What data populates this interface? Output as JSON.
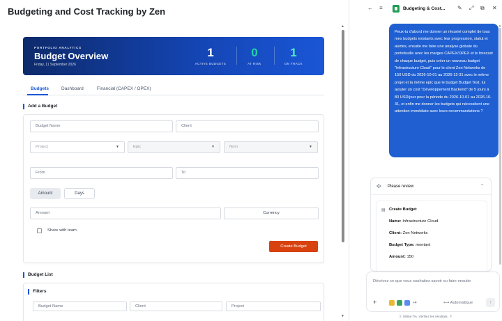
{
  "page": {
    "title": "Budgeting and Cost Tracking by Zen"
  },
  "hero": {
    "eyebrow": "PORTFOLIO ANALYTICS",
    "title": "Budget Overview",
    "date": "Friday, 11 September 2026",
    "stats": [
      {
        "value": "1",
        "label": "ACTIVE BUDGETS"
      },
      {
        "value": "0",
        "label": "AT RISK"
      },
      {
        "value": "1",
        "label": "ON TRACK"
      }
    ],
    "colors": {
      "gradient_start": "#0d2a6b",
      "gradient_end": "#1a56d6",
      "at_risk": "#22d3a6",
      "on_track": "#4ef0c8"
    }
  },
  "tabs": [
    "Budgets",
    "Dashboard",
    "Financial (CAPEX / OPEX)"
  ],
  "add_budget": {
    "section_label": "Add a Budget",
    "budget_name_placeholder": "Budget Name",
    "client_placeholder": "Client",
    "project_placeholder": "Project",
    "epic_placeholder": "Epic",
    "nom_placeholder": "Nom",
    "from_placeholder": "From",
    "to_placeholder": "To",
    "toggle_amount": "Amount",
    "toggle_days": "Days",
    "amount_placeholder": "Amount",
    "currency_label": "Currency",
    "share_label": "Share with team",
    "create_button": "Create Budget",
    "accent_color": "#d8420f"
  },
  "budget_list": {
    "section_label": "Budget List",
    "filters_label": "Filters",
    "filter_budget_name": "Budget Name",
    "filter_client": "Client",
    "filter_project": "Project"
  },
  "assistant": {
    "title": "Budgeting & Cost...",
    "message": "Peux-tu d'abord me donner un résumé complet de tous mes budgets existants avec leur progression, statut et alertes, ensuite me faire une analyse globale du portefeuille avec les marges CAPEX/OPEX et le forecast de chaque budget, puis créer un nouveau budget \"Infrastructure Cloud\" pour le client Zen Networks de 150 USD du 2026-10-01 au 2026-12-31 avec le même projet et la même epic que le budget Budget Test, lui ajouter un cost \"Développement Backend\" de 5 jours à 80 USD/jour pour la période du 2026-10-01 au 2026-10-31, et enfin me donner les budgets qui nécessitent une attention immédiate avec leurs recommandations ?",
    "review": {
      "title": "Please review",
      "action": "Create Budget",
      "fields": [
        {
          "label": "Name:",
          "value": "Infrastructure Cloud"
        },
        {
          "label": "Client:",
          "value": "Zen Networks"
        },
        {
          "label": "Budget Type:",
          "value": "montant"
        },
        {
          "label": "Amount:",
          "value": "150"
        }
      ]
    },
    "input_placeholder": "Décrivez ce que vous souhaitez savoir ou faire ensuite",
    "chip_count": "+4",
    "mode_label": "Automatique",
    "footnote": "Utilise l'IA. Vérifiez les résultats.",
    "bubble_color": "#1f5fd1"
  }
}
